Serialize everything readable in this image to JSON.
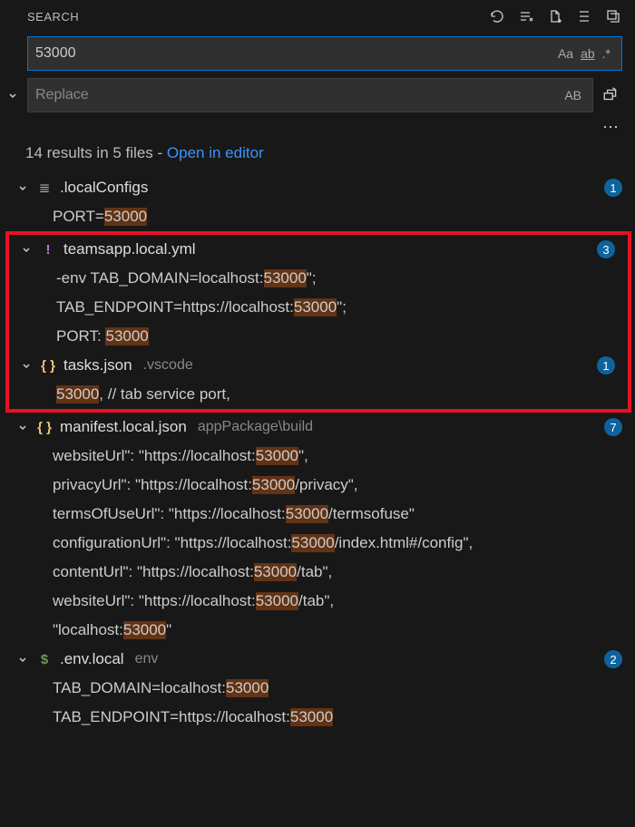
{
  "header": {
    "title": "SEARCH"
  },
  "search": {
    "value": "53000",
    "case": "Aa",
    "word": "ab",
    "regex": ".*"
  },
  "replace": {
    "placeholder": "Replace",
    "preserve": "AB"
  },
  "more": "⋯",
  "summary": {
    "text": "14 results in 5 files - ",
    "link": "Open in editor"
  },
  "files": [
    {
      "icon": "lines",
      "name": ".localConfigs",
      "path": "",
      "count": 1,
      "matches": [
        {
          "pre": "PORT=",
          "hit": "53000",
          "post": ""
        }
      ]
    },
    {
      "icon": "yaml",
      "name": "teamsapp.local.yml",
      "path": "",
      "count": 3,
      "matches": [
        {
          "pre": "-env TAB_DOMAIN=localhost:",
          "hit": "53000",
          "post": "\";"
        },
        {
          "pre": "TAB_ENDPOINT=https://localhost:",
          "hit": "53000",
          "post": "\";"
        },
        {
          "pre": "PORT: ",
          "hit": "53000",
          "post": ""
        }
      ]
    },
    {
      "icon": "json",
      "name": "tasks.json",
      "path": ".vscode",
      "count": 1,
      "matches": [
        {
          "pre": "",
          "hit": "53000",
          "post": ", // tab service port,"
        }
      ]
    },
    {
      "icon": "json",
      "name": "manifest.local.json",
      "path": "appPackage\\build",
      "count": 7,
      "matches": [
        {
          "pre": "websiteUrl\": \"https://localhost:",
          "hit": "53000",
          "post": "\","
        },
        {
          "pre": "privacyUrl\": \"https://localhost:",
          "hit": "53000",
          "post": "/privacy\","
        },
        {
          "pre": "termsOfUseUrl\": \"https://localhost:",
          "hit": "53000",
          "post": "/termsofuse\""
        },
        {
          "pre": "configurationUrl\": \"https://localhost:",
          "hit": "53000",
          "post": "/index.html#/config\","
        },
        {
          "pre": "contentUrl\": \"https://localhost:",
          "hit": "53000",
          "post": "/tab\","
        },
        {
          "pre": "websiteUrl\": \"https://localhost:",
          "hit": "53000",
          "post": "/tab\","
        },
        {
          "pre": "\"localhost:",
          "hit": "53000",
          "post": "\""
        }
      ]
    },
    {
      "icon": "env",
      "name": ".env.local",
      "path": "env",
      "count": 2,
      "matches": [
        {
          "pre": "TAB_DOMAIN=localhost:",
          "hit": "53000",
          "post": ""
        },
        {
          "pre": "TAB_ENDPOINT=https://localhost:",
          "hit": "53000",
          "post": ""
        }
      ]
    }
  ]
}
